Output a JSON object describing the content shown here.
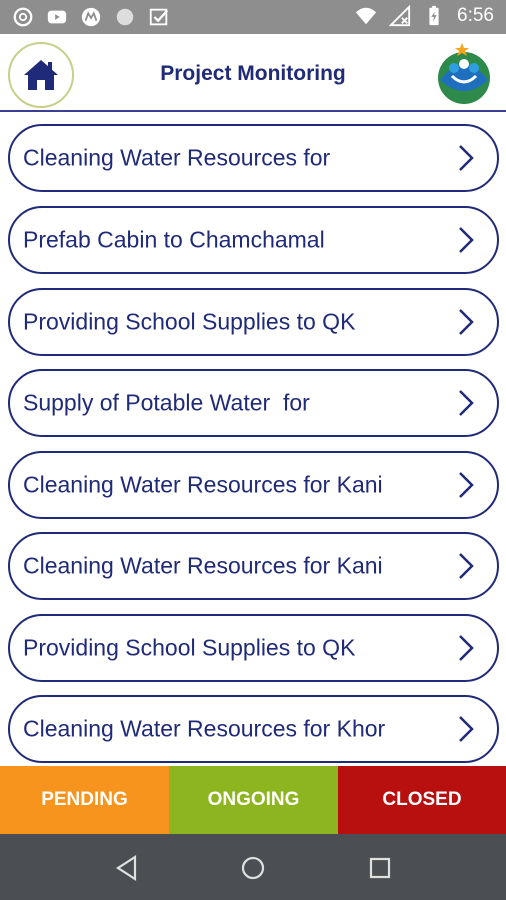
{
  "status_bar": {
    "time": "6:56",
    "left_icons": [
      "data-saver-icon",
      "youtube-icon",
      "motorola-icon",
      "circle-notification-icon",
      "check-box-icon"
    ],
    "right_icons": [
      "wifi-icon",
      "no-signal-icon",
      "battery-charging-icon"
    ]
  },
  "header": {
    "title": "Project Monitoring",
    "home_icon": "home-icon",
    "logo_icon": "organization-logo"
  },
  "projects": [
    {
      "label": "Cleaning Water Resources for"
    },
    {
      "label": "Prefab Cabin to Chamchamal"
    },
    {
      "label": "Providing School Supplies to QK"
    },
    {
      "label": "Supply of Potable Water  for"
    },
    {
      "label": "Cleaning Water Resources for Kani"
    },
    {
      "label": "Cleaning Water Resources for Kani"
    },
    {
      "label": "Providing School Supplies to QK"
    },
    {
      "label": "Cleaning Water Resources for Khor"
    }
  ],
  "tabs": {
    "pending": "PENDING",
    "ongoing": "ONGOING",
    "closed": "CLOSED"
  },
  "colors": {
    "primary": "#1f2a78",
    "pending": "#f7941d",
    "ongoing": "#8cb51f",
    "closed": "#b80f0f",
    "status_bar": "#8e8e8e",
    "nav_bar": "#4b4e52"
  },
  "nav_bar": {
    "icons": [
      "back-icon",
      "home-circle-icon",
      "recents-icon"
    ]
  }
}
